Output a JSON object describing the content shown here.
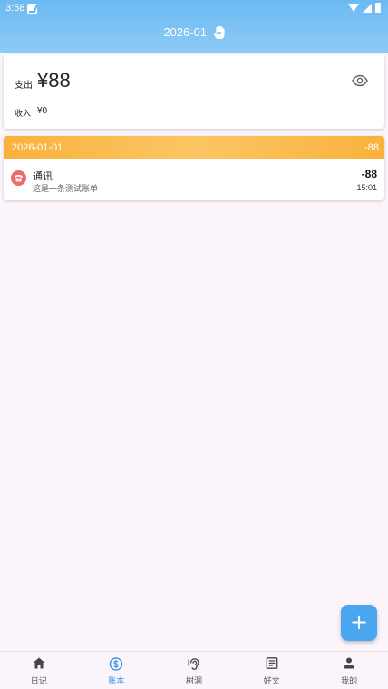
{
  "status_bar": {
    "time": "3:58"
  },
  "header": {
    "title": "2026-01"
  },
  "summary": {
    "expense_label": "支出",
    "expense_value": "¥88",
    "income_label": "收入",
    "income_value": "¥0"
  },
  "days": [
    {
      "date": "2026-01-01",
      "total": "-88",
      "entries": [
        {
          "category": "通讯",
          "note": "这是一条测试账单",
          "amount": "-88",
          "time": "15:01",
          "icon": "phone-icon"
        }
      ]
    }
  ],
  "fab": {
    "label": "+"
  },
  "nav": {
    "active": "账本",
    "items": [
      {
        "label": "日记",
        "icon": "home-icon"
      },
      {
        "label": "账本",
        "icon": "dollar-icon"
      },
      {
        "label": "树洞",
        "icon": "ear-icon"
      },
      {
        "label": "好文",
        "icon": "article-icon"
      },
      {
        "label": "我的",
        "icon": "person-icon"
      }
    ]
  },
  "colors": {
    "header": "#6cbaf2",
    "day_header": "#f9b13c",
    "category_icon": "#f0696b",
    "accent": "#4aa6ef"
  }
}
